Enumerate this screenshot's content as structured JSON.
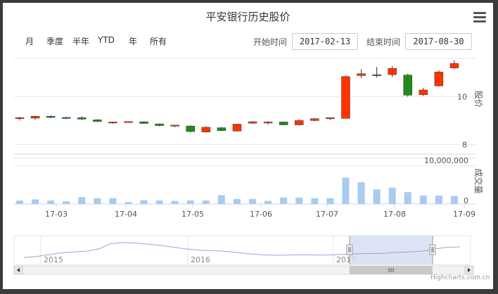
{
  "title": "平安银行历史股价",
  "range_buttons": [
    "月",
    "季度",
    "半年",
    "YTD",
    "年",
    "所有"
  ],
  "start_label": "开始时间",
  "start_value": "2017-02-13",
  "end_label": "结束时间",
  "end_value": "2017-08-30",
  "credits": "Highcharts.com.cn",
  "colors": {
    "up": "#ff3300",
    "down": "#238a1b",
    "volume": "#a8cbef",
    "navigator_mask": "#d5dcf2",
    "navigator_line": "#90a8d8"
  },
  "chart_data": {
    "type": "candlestick",
    "price_axis": {
      "title": "股价",
      "ticks": [
        8,
        10
      ],
      "range": [
        7.6,
        11.6
      ]
    },
    "volume_axis": {
      "title": "成交量",
      "ticks": [
        "0",
        "10,000,000"
      ],
      "range": [
        0,
        12000000
      ]
    },
    "x_axis": {
      "ticks": [
        "17-03",
        "17-04",
        "17-05",
        "17-06",
        "17-07",
        "17-08",
        "17-09"
      ]
    },
    "candles": [
      {
        "o": 9.09,
        "h": 9.16,
        "l": 9.0,
        "c": 9.12
      },
      {
        "o": 9.1,
        "h": 9.2,
        "l": 9.04,
        "c": 9.18
      },
      {
        "o": 9.18,
        "h": 9.22,
        "l": 9.1,
        "c": 9.13
      },
      {
        "o": 9.13,
        "h": 9.16,
        "l": 9.06,
        "c": 9.11
      },
      {
        "o": 9.12,
        "h": 9.18,
        "l": 9.02,
        "c": 9.06
      },
      {
        "o": 9.03,
        "h": 9.06,
        "l": 8.94,
        "c": 8.96
      },
      {
        "o": 8.92,
        "h": 8.96,
        "l": 8.86,
        "c": 8.94
      },
      {
        "o": 8.94,
        "h": 8.97,
        "l": 8.9,
        "c": 8.96
      },
      {
        "o": 8.95,
        "h": 8.96,
        "l": 8.86,
        "c": 8.88
      },
      {
        "o": 8.86,
        "h": 8.88,
        "l": 8.76,
        "c": 8.79
      },
      {
        "o": 8.79,
        "h": 8.82,
        "l": 8.72,
        "c": 8.81
      },
      {
        "o": 8.77,
        "h": 8.8,
        "l": 8.5,
        "c": 8.54
      },
      {
        "o": 8.52,
        "h": 8.76,
        "l": 8.5,
        "c": 8.72
      },
      {
        "o": 8.7,
        "h": 8.73,
        "l": 8.56,
        "c": 8.58
      },
      {
        "o": 8.56,
        "h": 8.86,
        "l": 8.55,
        "c": 8.85
      },
      {
        "o": 8.89,
        "h": 8.98,
        "l": 8.87,
        "c": 8.95
      },
      {
        "o": 8.92,
        "h": 8.98,
        "l": 8.84,
        "c": 8.94
      },
      {
        "o": 8.94,
        "h": 8.96,
        "l": 8.8,
        "c": 8.82
      },
      {
        "o": 8.82,
        "h": 9.06,
        "l": 8.8,
        "c": 9.0
      },
      {
        "o": 9.0,
        "h": 9.1,
        "l": 8.97,
        "c": 9.08
      },
      {
        "o": 9.08,
        "h": 9.14,
        "l": 9.02,
        "c": 9.12
      },
      {
        "o": 9.09,
        "h": 10.88,
        "l": 9.08,
        "c": 10.84
      },
      {
        "o": 10.88,
        "h": 11.14,
        "l": 10.78,
        "c": 10.96
      },
      {
        "o": 10.92,
        "h": 11.24,
        "l": 10.8,
        "c": 10.88
      },
      {
        "o": 10.92,
        "h": 11.28,
        "l": 10.82,
        "c": 11.18
      },
      {
        "o": 10.9,
        "h": 10.96,
        "l": 10.0,
        "c": 10.06
      },
      {
        "o": 10.08,
        "h": 10.36,
        "l": 10.02,
        "c": 10.28
      },
      {
        "o": 10.45,
        "h": 11.1,
        "l": 10.42,
        "c": 11.03
      },
      {
        "o": 11.2,
        "h": 11.52,
        "l": 11.16,
        "c": 11.39
      }
    ],
    "volumes": [
      900000,
      1200000,
      900000,
      700000,
      1800000,
      1500000,
      1500000,
      500000,
      1000000,
      900000,
      800000,
      900000,
      900000,
      2300000,
      1300000,
      1300000,
      800000,
      1700000,
      1700000,
      1500000,
      1500000,
      6900000,
      5700000,
      3800000,
      4300000,
      3100000,
      2200000,
      2200000,
      2100000
    ],
    "navigator": {
      "year_labels": [
        "2015",
        "2016",
        "2017"
      ]
    }
  }
}
